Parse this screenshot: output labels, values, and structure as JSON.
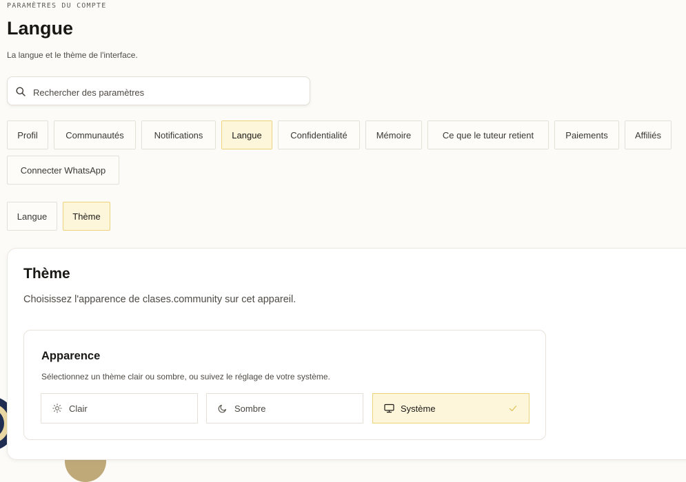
{
  "header": {
    "eyebrow": "PARAMÈTRES DU COMPTE",
    "title": "Langue",
    "subtitle": "La langue et le thème de l'interface."
  },
  "search": {
    "placeholder": "Rechercher des paramètres",
    "icon": "search-icon"
  },
  "tabs": [
    {
      "label": "Profil",
      "active": false
    },
    {
      "label": "Communautés",
      "active": false
    },
    {
      "label": "Notifications",
      "active": false
    },
    {
      "label": "Langue",
      "active": true
    },
    {
      "label": "Confidentialité",
      "active": false
    },
    {
      "label": "Mémoire",
      "active": false
    },
    {
      "label": "Ce que le tuteur retient",
      "active": false
    },
    {
      "label": "Paiements",
      "active": false
    },
    {
      "label": "Affiliés",
      "active": false
    },
    {
      "label": "Connecter WhatsApp",
      "active": false
    }
  ],
  "subtabs": [
    {
      "label": "Langue",
      "active": false
    },
    {
      "label": "Thème",
      "active": true
    }
  ],
  "theme_card": {
    "title": "Thème",
    "description": "Choisissez l'apparence de clases.community sur cet appareil.",
    "appearance": {
      "title": "Apparence",
      "description": "Sélectionnez un thème clair ou sombre, ou suivez le réglage de votre système.",
      "options": [
        {
          "label": "Clair",
          "icon": "sun-icon",
          "selected": false
        },
        {
          "label": "Sombre",
          "icon": "moon-icon",
          "selected": false
        },
        {
          "label": "Système",
          "icon": "monitor-icon",
          "selected": true
        }
      ]
    }
  },
  "colors": {
    "accent_bg": "#fdf6da",
    "accent_border": "#ecd27b",
    "check": "#e0c45c",
    "page_bg": "#fcfbf7"
  }
}
